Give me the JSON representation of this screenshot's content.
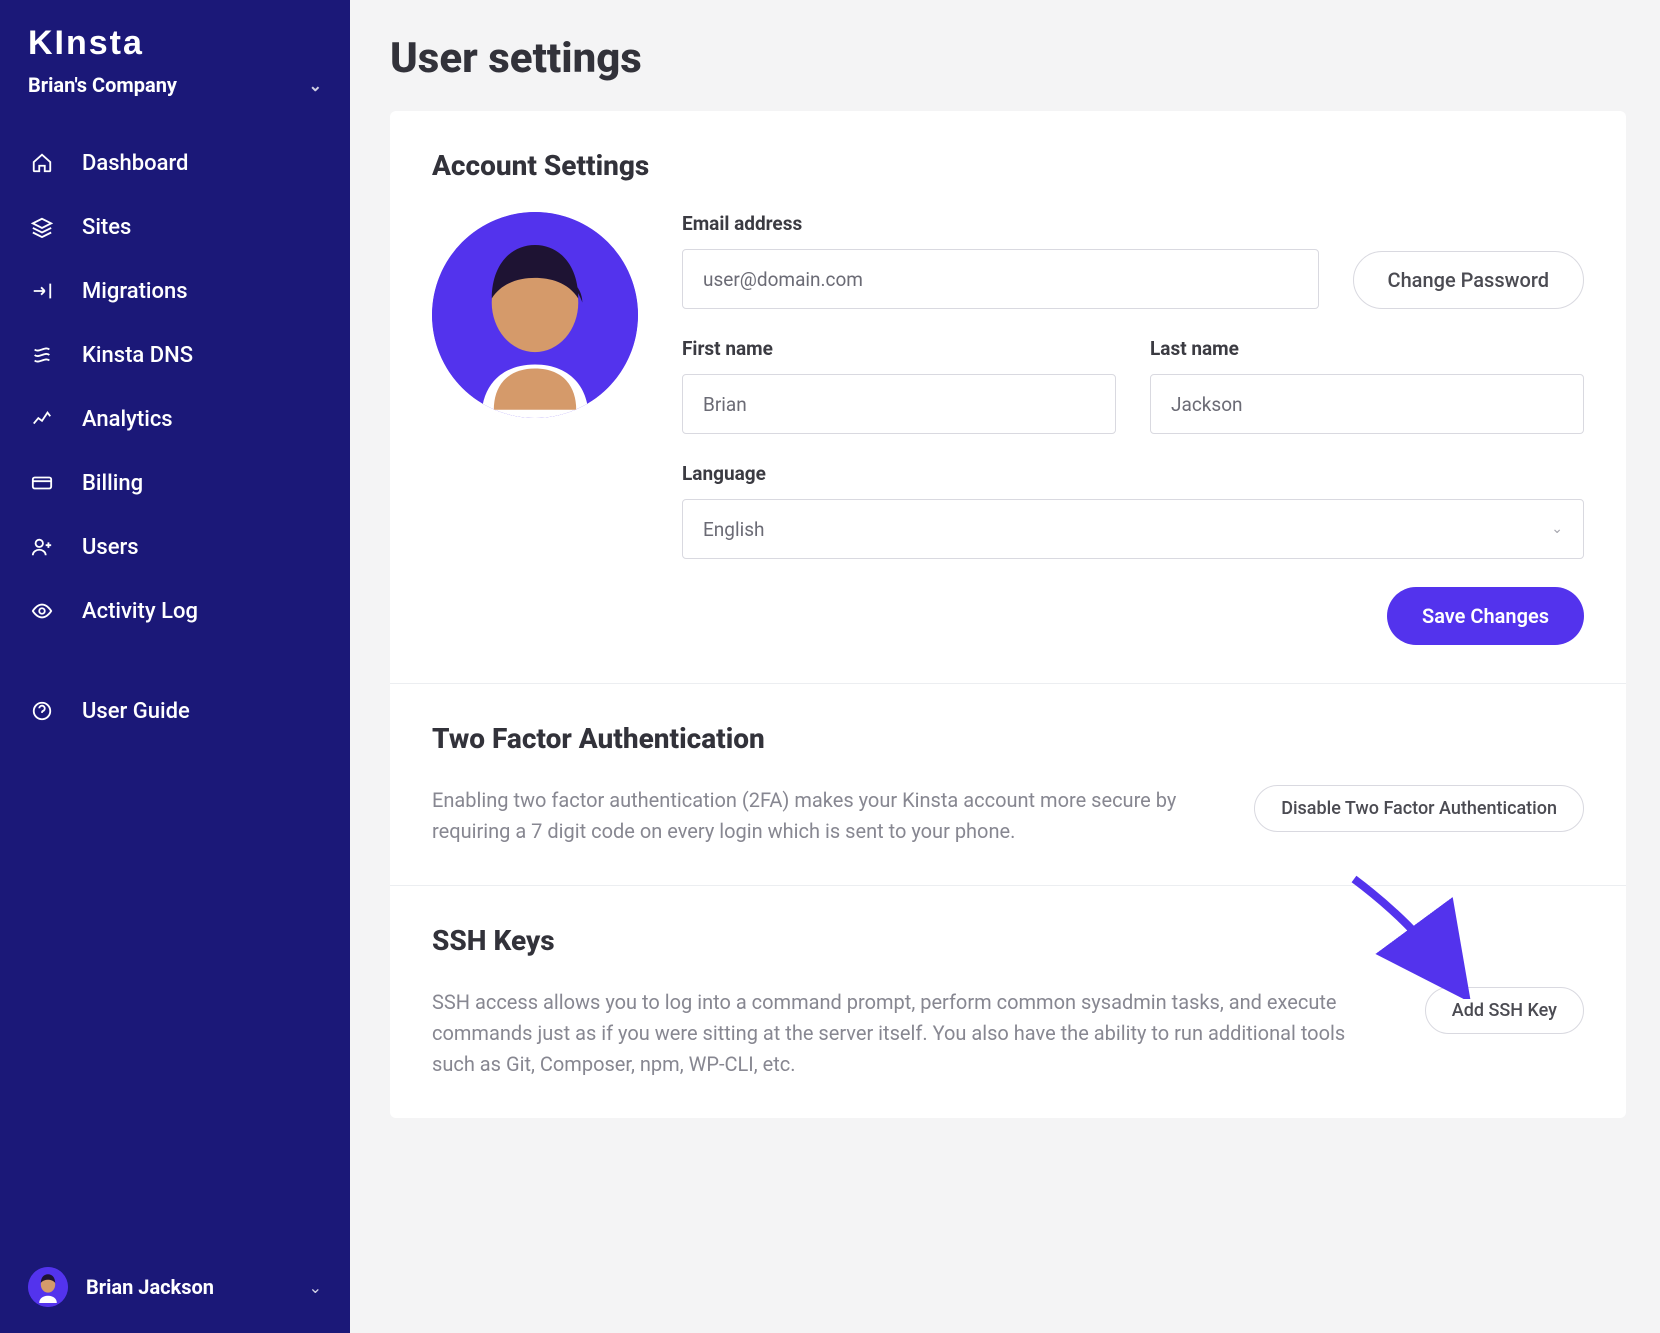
{
  "brand": "KInsta",
  "company": "Brian's Company",
  "nav": [
    {
      "icon": "home",
      "label": "Dashboard"
    },
    {
      "icon": "layers",
      "label": "Sites"
    },
    {
      "icon": "migrate",
      "label": "Migrations"
    },
    {
      "icon": "dns",
      "label": "Kinsta DNS"
    },
    {
      "icon": "analytics",
      "label": "Analytics"
    },
    {
      "icon": "billing",
      "label": "Billing"
    },
    {
      "icon": "users",
      "label": "Users"
    },
    {
      "icon": "eye",
      "label": "Activity Log"
    },
    {
      "icon": "help",
      "label": "User Guide"
    }
  ],
  "footer_user": "Brian Jackson",
  "page_title": "User settings",
  "account": {
    "title": "Account Settings",
    "email_label": "Email address",
    "email_value": "user@domain.com",
    "change_password_btn": "Change Password",
    "first_name_label": "First name",
    "first_name_value": "Brian",
    "last_name_label": "Last name",
    "last_name_value": "Jackson",
    "language_label": "Language",
    "language_value": "English",
    "save_btn": "Save Changes"
  },
  "tfa": {
    "title": "Two Factor Authentication",
    "desc": "Enabling two factor authentication (2FA) makes your Kinsta account more secure by requiring a 7 digit code on every login which is sent to your phone.",
    "btn": "Disable Two Factor Authentication"
  },
  "ssh": {
    "title": "SSH Keys",
    "desc": "SSH access allows you to log into a command prompt, perform common sysadmin tasks, and execute commands just as if you were sitting at the server itself. You also have the ability to run additional tools such as Git, Composer, npm, WP-CLI, etc.",
    "btn": "Add SSH Key"
  }
}
